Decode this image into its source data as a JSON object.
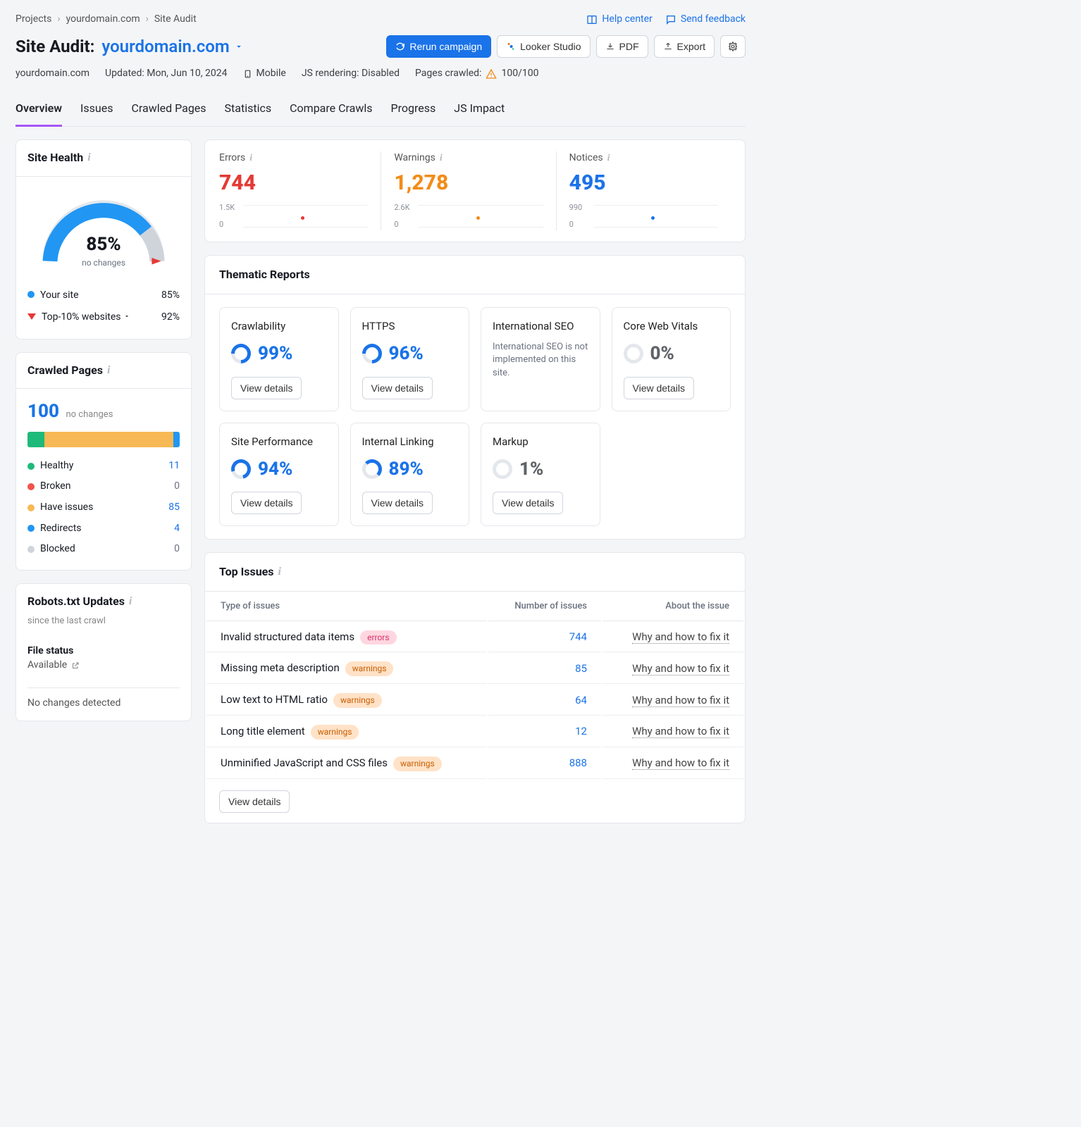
{
  "breadcrumb": [
    "Projects",
    "yourdomain.com",
    "Site Audit"
  ],
  "toplinks": {
    "help": "Help center",
    "feedback": "Send feedback"
  },
  "title": {
    "prefix": "Site Audit:",
    "domain": "yourdomain.com"
  },
  "actions": {
    "rerun": "Rerun campaign",
    "looker": "Looker Studio",
    "pdf": "PDF",
    "export": "Export"
  },
  "meta": {
    "domain": "yourdomain.com",
    "updated": "Updated: Mon, Jun 10, 2024",
    "device": "Mobile",
    "js": "JS rendering: Disabled",
    "crawled_label": "Pages crawled:",
    "crawled_value": "100/100"
  },
  "tabs": [
    "Overview",
    "Issues",
    "Crawled Pages",
    "Statistics",
    "Compare Crawls",
    "Progress",
    "JS Impact"
  ],
  "active_tab": "Overview",
  "site_health": {
    "title": "Site Health",
    "percent": "85%",
    "sub": "no changes",
    "your_site": "Your site",
    "your_site_val": "85%",
    "top10": "Top-10% websites",
    "top10_val": "92%"
  },
  "stats": {
    "errors": {
      "label": "Errors",
      "value": "744",
      "spark_top": "1.5K",
      "spark_bot": "0"
    },
    "warnings": {
      "label": "Warnings",
      "value": "1,278",
      "spark_top": "2.6K",
      "spark_bot": "0"
    },
    "notices": {
      "label": "Notices",
      "value": "495",
      "spark_top": "990",
      "spark_bot": "0"
    }
  },
  "crawled": {
    "title": "Crawled Pages",
    "num": "100",
    "sub": "no changes",
    "items": [
      {
        "label": "Healthy",
        "value": "11",
        "color": "#1eba7a",
        "zero": false
      },
      {
        "label": "Broken",
        "value": "0",
        "color": "#f0534a",
        "zero": true
      },
      {
        "label": "Have issues",
        "value": "85",
        "color": "#f7b955",
        "zero": false
      },
      {
        "label": "Redirects",
        "value": "4",
        "color": "#2196f3",
        "zero": false
      },
      {
        "label": "Blocked",
        "value": "0",
        "color": "#cfd3da",
        "zero": true
      }
    ]
  },
  "thematic": {
    "title": "Thematic Reports",
    "view": "View details",
    "cards": [
      {
        "label": "Crawlability",
        "pct": "99%",
        "ring": "ring-blue"
      },
      {
        "label": "HTTPS",
        "pct": "96%",
        "ring": "ring-blue"
      },
      {
        "label": "International SEO",
        "note": "International SEO is not implemented on this site."
      },
      {
        "label": "Core Web Vitals",
        "pct": "0%",
        "ring": "ring-gray"
      },
      {
        "label": "Site Performance",
        "pct": "94%",
        "ring": "ring-blue94"
      },
      {
        "label": "Internal Linking",
        "pct": "89%",
        "ring": "ring-blue89"
      },
      {
        "label": "Markup",
        "pct": "1%",
        "ring": "ring-gray"
      }
    ]
  },
  "robots": {
    "title": "Robots.txt Updates",
    "sub": "since the last crawl",
    "status_label": "File status",
    "status_value": "Available",
    "nochanges": "No changes detected"
  },
  "top_issues": {
    "title": "Top Issues",
    "cols": [
      "Type of issues",
      "Number of issues",
      "About the issue"
    ],
    "view": "View details",
    "fix": "Why and how to fix it",
    "rows": [
      {
        "name": "Invalid structured data items",
        "pill": "errors",
        "pillclass": "err",
        "num": "744"
      },
      {
        "name": "Missing meta description",
        "pill": "warnings",
        "pillclass": "warn",
        "num": "85"
      },
      {
        "name": "Low text to HTML ratio",
        "pill": "warnings",
        "pillclass": "warn",
        "num": "64"
      },
      {
        "name": "Long title element",
        "pill": "warnings",
        "pillclass": "warn",
        "num": "12"
      },
      {
        "name": "Unminified JavaScript and CSS files",
        "pill": "warnings",
        "pillclass": "warn",
        "num": "888"
      }
    ]
  },
  "chart_data": {
    "site_health_gauge": {
      "type": "gauge",
      "value": 85,
      "range": [
        0,
        100
      ]
    },
    "crawled_stack": {
      "type": "stacked-bar",
      "series": [
        {
          "name": "Healthy",
          "value": 11,
          "color": "#1eba7a"
        },
        {
          "name": "Broken",
          "value": 0,
          "color": "#f0534a"
        },
        {
          "name": "Have issues",
          "value": 85,
          "color": "#f7b955"
        },
        {
          "name": "Redirects",
          "value": 4,
          "color": "#2196f3"
        },
        {
          "name": "Blocked",
          "value": 0,
          "color": "#cfd3da"
        }
      ],
      "total": 100
    },
    "sparklines": [
      {
        "name": "Errors",
        "ylim": [
          0,
          1500
        ],
        "points": [
          744
        ]
      },
      {
        "name": "Warnings",
        "ylim": [
          0,
          2600
        ],
        "points": [
          1278
        ]
      },
      {
        "name": "Notices",
        "ylim": [
          0,
          990
        ],
        "points": [
          495
        ]
      }
    ]
  }
}
